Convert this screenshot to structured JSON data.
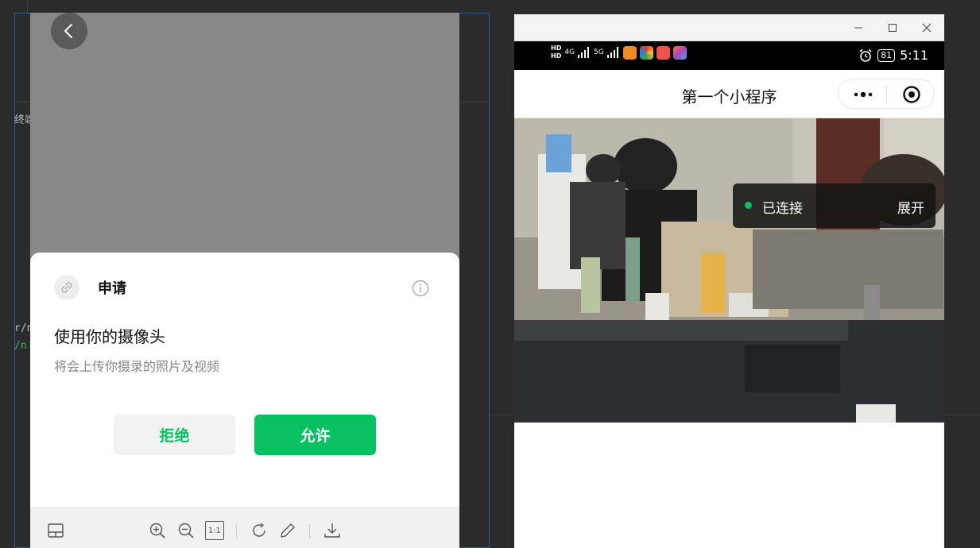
{
  "background": {
    "text_lines": [
      "终端",
      "r/n",
      "/n"
    ]
  },
  "permission_dialog": {
    "header_title": "申请",
    "title": "使用你的摄像头",
    "description": "将会上传你摄录的照片及视频",
    "reject_label": "拒绝",
    "allow_label": "允许",
    "accent_color": "#07c160",
    "toolbar_icons": [
      "layout-icon",
      "zoom-in-icon",
      "zoom-out-icon",
      "actual-size-icon",
      "rotate-icon",
      "edit-icon",
      "download-icon"
    ],
    "actual_size_label": "1:1"
  },
  "simulator": {
    "status": {
      "network_hd1": "HD",
      "network_hd2": "HD",
      "sig1_label": "4G",
      "sig2_label": "5G",
      "battery": "81",
      "time": "5:11"
    },
    "nav_title": "第一个小程序",
    "connection": {
      "status": "已连接",
      "expand_label": "展开"
    }
  }
}
